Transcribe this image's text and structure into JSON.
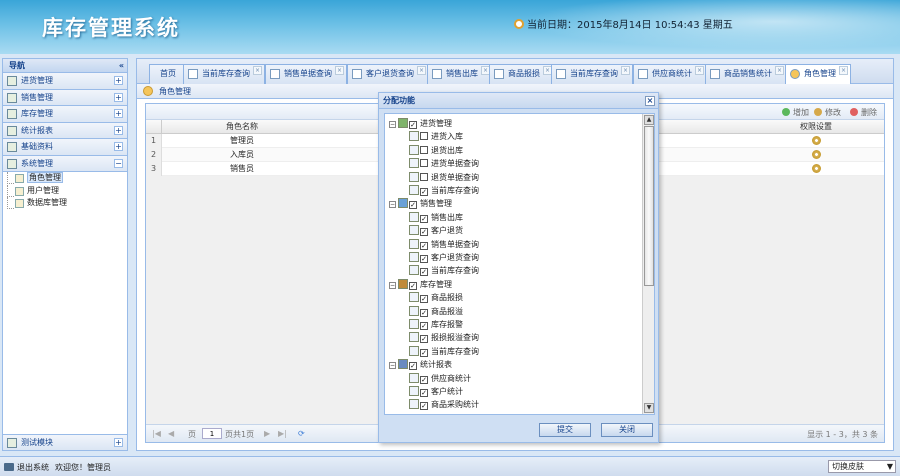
{
  "app": {
    "title": "库存管理系统",
    "date_text": "当前日期：2015年8月14日 10:54:43 星期五"
  },
  "nav": {
    "title": "导航",
    "collapse": "«",
    "groups": [
      {
        "label": "进货管理",
        "toggle": "+"
      },
      {
        "label": "销售管理",
        "toggle": "+"
      },
      {
        "label": "库存管理",
        "toggle": "+"
      },
      {
        "label": "统计报表",
        "toggle": "+"
      },
      {
        "label": "基础资料",
        "toggle": "+"
      },
      {
        "label": "系统管理",
        "toggle": "−"
      }
    ],
    "items": [
      "角色管理",
      "用户管理",
      "数据库管理"
    ],
    "bottom": {
      "label": "测试模块",
      "toggle": "+"
    }
  },
  "tabs": [
    "首页",
    "当前库存查询",
    "销售单据查询",
    "客户退货查询",
    "销售出库",
    "商品报损",
    "当前库存查询",
    "供应商统计",
    "商品销售统计",
    "角色管理"
  ],
  "panel": {
    "title": "角色管理",
    "toolbar": {
      "add": "增加",
      "edit": "修改",
      "del": "删除"
    },
    "columns": {
      "name": "角色名称",
      "perm": "权限设置"
    },
    "rows": [
      {
        "num": "1",
        "name": "管理员"
      },
      {
        "num": "2",
        "name": "入库员"
      },
      {
        "num": "3",
        "name": "销售员"
      }
    ],
    "pager": {
      "page_label": "页",
      "page": "1",
      "of": "页共1页",
      "summary": "显示 1 - 3，共 3 条"
    }
  },
  "dialog": {
    "title": "分配功能",
    "tree": [
      {
        "label": "进货管理",
        "level": 0,
        "checked": true
      },
      {
        "label": "进货入库",
        "level": 1,
        "checked": false
      },
      {
        "label": "退货出库",
        "level": 1,
        "checked": false
      },
      {
        "label": "进货单据查询",
        "level": 1,
        "checked": false
      },
      {
        "label": "退货单据查询",
        "level": 1,
        "checked": false
      },
      {
        "label": "当前库存查询",
        "level": 1,
        "checked": true
      },
      {
        "label": "销售管理",
        "level": 0,
        "checked": true
      },
      {
        "label": "销售出库",
        "level": 1,
        "checked": true
      },
      {
        "label": "客户退货",
        "level": 1,
        "checked": true
      },
      {
        "label": "销售单据查询",
        "level": 1,
        "checked": true
      },
      {
        "label": "客户退货查询",
        "level": 1,
        "checked": true
      },
      {
        "label": "当前库存查询",
        "level": 1,
        "checked": true
      },
      {
        "label": "库存管理",
        "level": 0,
        "checked": true
      },
      {
        "label": "商品报损",
        "level": 1,
        "checked": true
      },
      {
        "label": "商品报溢",
        "level": 1,
        "checked": true
      },
      {
        "label": "库存报警",
        "level": 1,
        "checked": true
      },
      {
        "label": "报损报溢查询",
        "level": 1,
        "checked": true
      },
      {
        "label": "当前库存查询",
        "level": 1,
        "checked": true
      },
      {
        "label": "统计报表",
        "level": 0,
        "checked": true
      },
      {
        "label": "供应商统计",
        "level": 1,
        "checked": true
      },
      {
        "label": "客户统计",
        "level": 1,
        "checked": true
      },
      {
        "label": "商品采购统计",
        "level": 1,
        "checked": true
      }
    ],
    "submit": "提交",
    "close": "关闭",
    "close_x": "×"
  },
  "status": {
    "logout": "退出系统",
    "welcome": "欢迎您！管理员",
    "skin": "切换皮肤",
    "skin_arrow": "▼"
  }
}
